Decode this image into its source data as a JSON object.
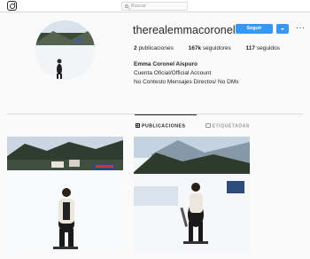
{
  "topbar": {
    "logo_icon": "instagram-glyph-icon",
    "search_placeholder": "Buscar"
  },
  "profile": {
    "username": "therealemmacoronel",
    "follow_label": "Seguir",
    "more_label": "···",
    "stats": {
      "posts_count": "2",
      "posts_label": "publicaciones",
      "followers_count": "167k",
      "followers_label": "seguidores",
      "following_count": "117",
      "following_label": "seguidos"
    },
    "bio": {
      "full_name": "Emma Coronel Aispuro",
      "line1": "Cuenta Oficial/Official Account",
      "line2": "No Contesto Mensajes Directos/ No DMs"
    }
  },
  "tabs": [
    {
      "label": "PUBLICACIONES",
      "icon": "grid-icon",
      "active": true
    },
    {
      "label": "ETIQUETADAS",
      "icon": "tag-icon",
      "active": false
    }
  ],
  "colors": {
    "accent": "#3897f0",
    "text": "#262626",
    "muted": "#999999",
    "border": "#dbdbdb"
  }
}
